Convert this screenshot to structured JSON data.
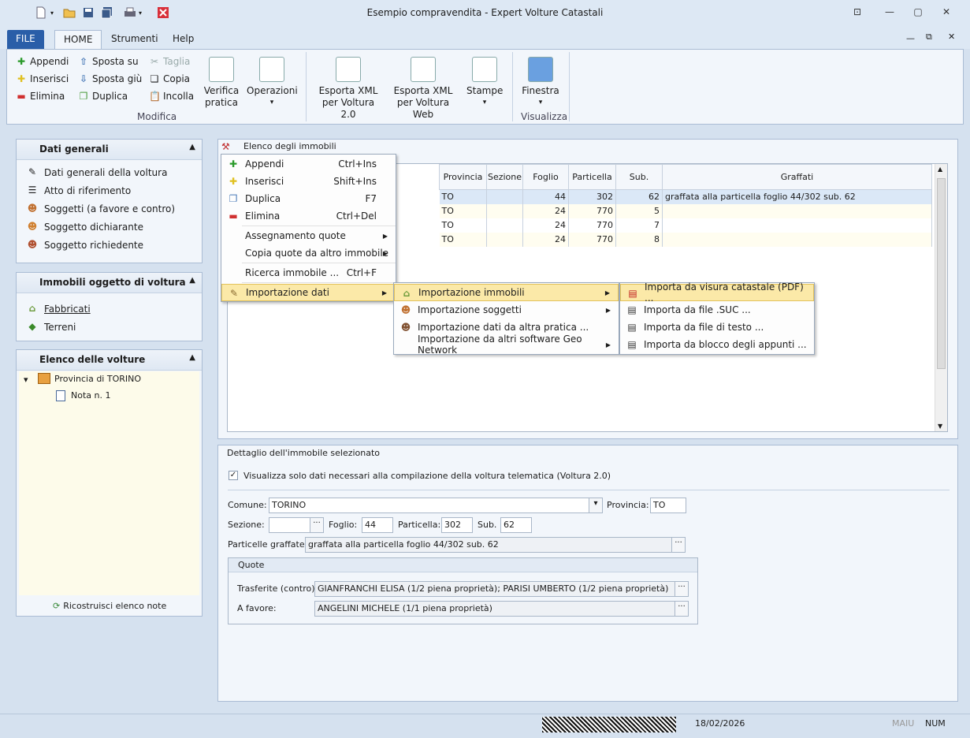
{
  "window": {
    "title": "Esempio compravendita - Expert Volture Catastali"
  },
  "tabs": {
    "file": "FILE",
    "home": "HOME",
    "strumenti": "Strumenti",
    "help": "Help"
  },
  "ribbon": {
    "modifica": {
      "appendi": "Appendi",
      "inserisci": "Inserisci",
      "elimina": "Elimina",
      "sposta_su": "Sposta su",
      "sposta_giu": "Sposta giù",
      "duplica": "Duplica",
      "taglia": "Taglia",
      "copia": "Copia",
      "incolla": "Incolla",
      "group": "Modifica"
    },
    "verifica": {
      "l1": "Verifica",
      "l2": "pratica"
    },
    "operazioni": {
      "l1": "Operazioni",
      "arrow": "▾"
    },
    "xml20": {
      "l1": "Esporta XML",
      "l2": "per Voltura 2.0"
    },
    "xmlweb": {
      "l1": "Esporta XML",
      "l2": "per Voltura Web"
    },
    "stampe": {
      "l1": "Stampe",
      "arrow": "▾"
    },
    "finestra": {
      "l1": "Finestra",
      "arrow": "▾",
      "group": "Visualizza"
    }
  },
  "left": {
    "dati_generali": {
      "title": "Dati generali",
      "items": [
        "Dati generali della voltura",
        "Atto di riferimento",
        "Soggetti (a favore e contro)",
        "Soggetto dichiarante",
        "Soggetto richiedente"
      ]
    },
    "immobili": {
      "title": "Immobili oggetto di voltura",
      "items": [
        "Fabbricati",
        "Terreni"
      ]
    },
    "volture": {
      "title": "Elenco delle volture",
      "root": "Provincia di TORINO",
      "child": "Nota n. 1",
      "rebuild": "Ricostruisci elenco note"
    }
  },
  "immobili_list": {
    "title": "Elenco degli immobili",
    "columns": [
      "Provincia",
      "Sezione",
      "Foglio",
      "Particella",
      "Sub.",
      "Graffati"
    ],
    "rows": [
      {
        "provincia": "TO",
        "sezione": "",
        "foglio": "44",
        "particella": "302",
        "sub": "62",
        "graffati": "graffata alla particella foglio 44/302 sub. 62"
      },
      {
        "provincia": "TO",
        "sezione": "",
        "foglio": "24",
        "particella": "770",
        "sub": "5",
        "graffati": ""
      },
      {
        "provincia": "TO",
        "sezione": "",
        "foglio": "24",
        "particella": "770",
        "sub": "7",
        "graffati": ""
      },
      {
        "provincia": "TO",
        "sezione": "",
        "foglio": "24",
        "particella": "770",
        "sub": "8",
        "graffati": ""
      }
    ]
  },
  "context_menu": {
    "items": [
      {
        "label": "Appendi",
        "shortcut": "Ctrl+Ins"
      },
      {
        "label": "Inserisci",
        "shortcut": "Shift+Ins"
      },
      {
        "label": "Duplica",
        "shortcut": "F7"
      },
      {
        "label": "Elimina",
        "shortcut": "Ctrl+Del"
      },
      {
        "label": "Assegnamento quote",
        "shortcut": ""
      },
      {
        "label": "Copia quote da altro immobile",
        "shortcut": ""
      },
      {
        "label": "Ricerca immobile ...",
        "shortcut": "Ctrl+F"
      },
      {
        "label": "Importazione dati",
        "shortcut": ""
      }
    ],
    "sub1": [
      "Importazione immobili",
      "Importazione soggetti",
      "Importazione dati da altra pratica ...",
      "Importazione da altri software Geo Network"
    ],
    "sub2": [
      "Importa da visura catastale (PDF) ...",
      "Importa da file .SUC ...",
      "Importa da file di testo ...",
      "Importa da blocco degli appunti ..."
    ]
  },
  "dettaglio": {
    "title": "Dettaglio dell'immobile selezionato",
    "checkbox": "Visualizza solo dati necessari alla compilazione della voltura telematica (Voltura 2.0)",
    "comune_label": "Comune:",
    "comune": "TORINO",
    "provincia_label": "Provincia:",
    "provincia": "TO",
    "sezione_label": "Sezione:",
    "sezione": "",
    "foglio_label": "Foglio:",
    "foglio": "44",
    "particella_label": "Particella:",
    "particella": "302",
    "sub_label": "Sub.",
    "sub": "62",
    "graffate_label": "Particelle graffate:",
    "graffate": "graffata alla particella foglio 44/302 sub. 62",
    "quote_title": "Quote",
    "trasferite_label": "Trasferite (contro):",
    "trasferite": "GIANFRANCHI ELISA (1/2 piena proprietà); PARISI UMBERTO (1/2 piena proprietà)",
    "favore_label": "A favore:",
    "favore": "ANGELINI MICHELE (1/1 piena proprietà)"
  },
  "status": {
    "date": "18/02/2026",
    "maiu": "MAIU",
    "num": "NUM"
  }
}
